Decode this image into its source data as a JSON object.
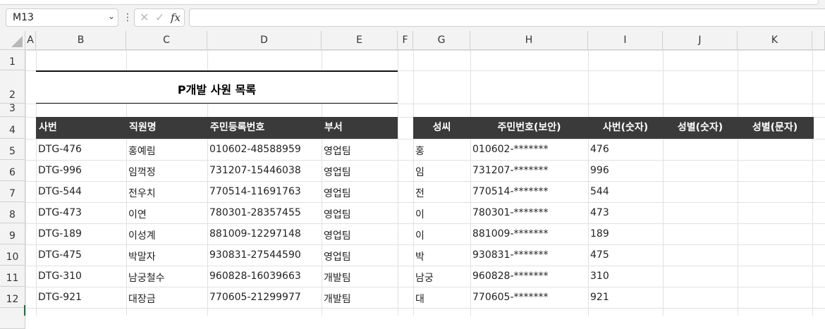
{
  "name_box": {
    "value": "M13"
  },
  "formula_bar": {
    "cancel_glyph": "✕",
    "enter_glyph": "✓",
    "fx_label": "fx",
    "formula": ""
  },
  "columns": [
    "A",
    "B",
    "C",
    "D",
    "E",
    "F",
    "G",
    "H",
    "I",
    "J",
    "K"
  ],
  "rows": [
    "1",
    "2",
    "3",
    "4",
    "5",
    "6",
    "7",
    "8",
    "9",
    "10",
    "11",
    "12"
  ],
  "title": "P개발 사원 목록",
  "left_table": {
    "headers": [
      "사번",
      "직원명",
      "주민등록번호",
      "부서"
    ],
    "rows": [
      [
        "DTG-476",
        "홍예림",
        "010602-48588959",
        "영업팀"
      ],
      [
        "DTG-996",
        "임꺽정",
        "731207-15446038",
        "영업팀"
      ],
      [
        "DTG-544",
        "전우치",
        "770514-11691763",
        "영업팀"
      ],
      [
        "DTG-473",
        "이연",
        "780301-28357455",
        "영업팀"
      ],
      [
        "DTG-189",
        "이성계",
        "881009-12297148",
        "영업팀"
      ],
      [
        "DTG-475",
        "박말자",
        "930831-27544590",
        "영업팀"
      ],
      [
        "DTG-310",
        "남궁철수",
        "960828-16039663",
        "개발팀"
      ],
      [
        "DTG-921",
        "대장금",
        "770605-21299977",
        "개발팀"
      ]
    ]
  },
  "right_table": {
    "headers": [
      "성씨",
      "주민번호(보안)",
      "사번(숫자)",
      "성별(숫자)",
      "성별(문자)"
    ],
    "rows": [
      [
        "홍",
        "010602-*******",
        "476",
        "",
        ""
      ],
      [
        "임",
        "731207-*******",
        "996",
        "",
        ""
      ],
      [
        "전",
        "770514-*******",
        "544",
        "",
        ""
      ],
      [
        "이",
        "780301-*******",
        "473",
        "",
        ""
      ],
      [
        "이",
        "881009-*******",
        "189",
        "",
        ""
      ],
      [
        "박",
        "930831-*******",
        "475",
        "",
        ""
      ],
      [
        "남궁",
        "960828-*******",
        "310",
        "",
        ""
      ],
      [
        "대",
        "770605-*******",
        "921",
        "",
        ""
      ]
    ]
  },
  "colors": {
    "header_fill": "#3a3a3a",
    "header_text": "#ffffff",
    "selection_green": "#1e7145"
  }
}
